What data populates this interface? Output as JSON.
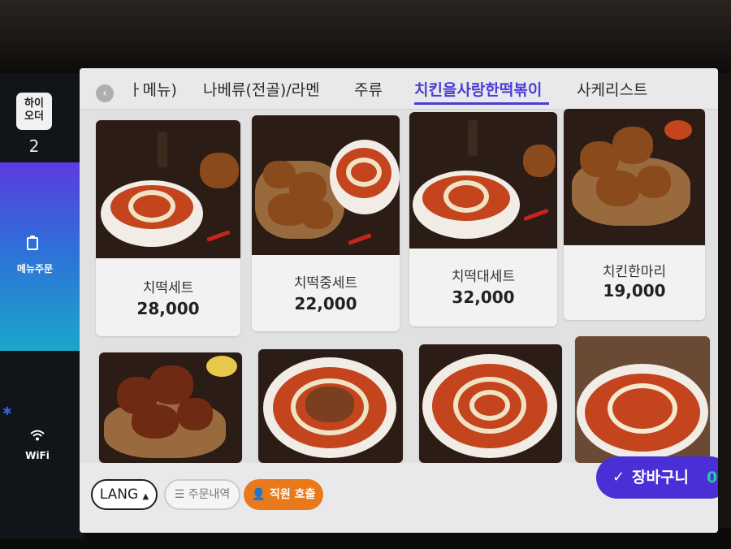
{
  "brand": {
    "line1": "하이",
    "line2": "오더"
  },
  "table_number": "2",
  "sidebar": {
    "menu_order_label": "메뉴주문",
    "wifi_label": "WiFi"
  },
  "tabs": [
    {
      "label": "ㅏ메뉴)",
      "active": false
    },
    {
      "label": "나베류(전골)/라멘",
      "active": false
    },
    {
      "label": "주류",
      "active": false
    },
    {
      "label": "치킨을사랑한떡볶이",
      "active": true
    },
    {
      "label": "사케리스트",
      "active": false
    }
  ],
  "menu_items": [
    {
      "name": "치떡세트",
      "price": "28,000"
    },
    {
      "name": "치떡중세트",
      "price": "22,000"
    },
    {
      "name": "치떡대세트",
      "price": "32,000"
    },
    {
      "name": "치킨한마리",
      "price": "19,000"
    },
    {
      "name": "",
      "price": ""
    },
    {
      "name": "",
      "price": ""
    },
    {
      "name": "",
      "price": ""
    },
    {
      "name": "",
      "price": ""
    }
  ],
  "bottom": {
    "lang_label": "LANG",
    "history_label": "주문내역",
    "call_label": "직원 호출",
    "cart_label": "장바구니",
    "cart_count": "0"
  },
  "colors": {
    "accent": "#4a3ed4",
    "cart": "#4a2fd6",
    "call": "#e87a1c",
    "cart_count": "#27c6a8"
  }
}
